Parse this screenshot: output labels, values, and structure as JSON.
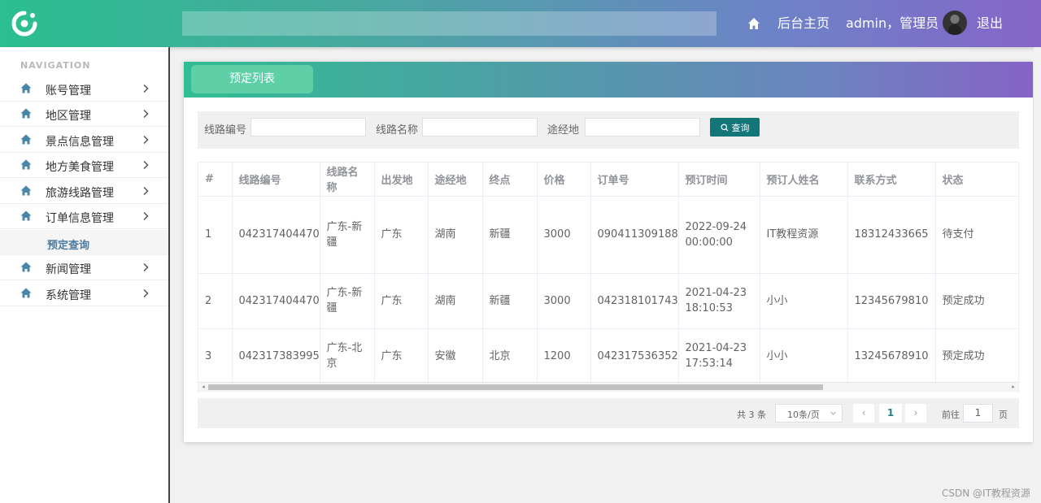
{
  "header": {
    "search_value": "",
    "home_label": "后台主页",
    "user_label": "admin，管理员",
    "logout_label": "退出"
  },
  "sidebar": {
    "nav_title": "NAVIGATION",
    "items": [
      {
        "label": "账号管理"
      },
      {
        "label": "地区管理"
      },
      {
        "label": "景点信息管理"
      },
      {
        "label": "地方美食管理"
      },
      {
        "label": "旅游线路管理"
      },
      {
        "label": "订单信息管理"
      },
      {
        "label": "新闻管理"
      },
      {
        "label": "系统管理"
      }
    ],
    "sub_item": "预定查询"
  },
  "card": {
    "tab_label": "预定列表"
  },
  "filter": {
    "route_no_label": "线路编号",
    "route_name_label": "线路名称",
    "via_label": "途经地",
    "search_button": "查询"
  },
  "table": {
    "headers": [
      "#",
      "线路编号",
      "线路名称",
      "出发地",
      "途经地",
      "终点",
      "价格",
      "订单号",
      "预订时间",
      "预订人姓名",
      "联系方式",
      "状态"
    ],
    "rows": [
      [
        "1",
        "042317404470",
        "广东-新疆",
        "广东",
        "湖南",
        "新疆",
        "3000",
        "090411309188",
        "2022-09-24 00:00:00",
        "IT教程资源",
        "18312433665",
        "待支付"
      ],
      [
        "2",
        "042317404470",
        "广东-新疆",
        "广东",
        "湖南",
        "新疆",
        "3000",
        "042318101743",
        "2021-04-23 18:10:53",
        "小小",
        "12345679810",
        "预定成功"
      ],
      [
        "3",
        "042317383995",
        "广东-北京",
        "广东",
        "安徽",
        "北京",
        "1200",
        "042317536352",
        "2021-04-23 17:53:14",
        "小小",
        "13245678910",
        "预定成功"
      ]
    ]
  },
  "pagination": {
    "total": "共 3 条",
    "page_size": "10条/页",
    "current_page": "1",
    "goto_label": "前往",
    "goto_value": "1",
    "page_unit": "页"
  },
  "watermark": "CSDN @IT教程资源",
  "colors": {
    "accent_green": "#2bbf8f",
    "accent_purple": "#8565c8",
    "search_button": "#13777a",
    "sub_item_text": "#4d7a9f"
  }
}
